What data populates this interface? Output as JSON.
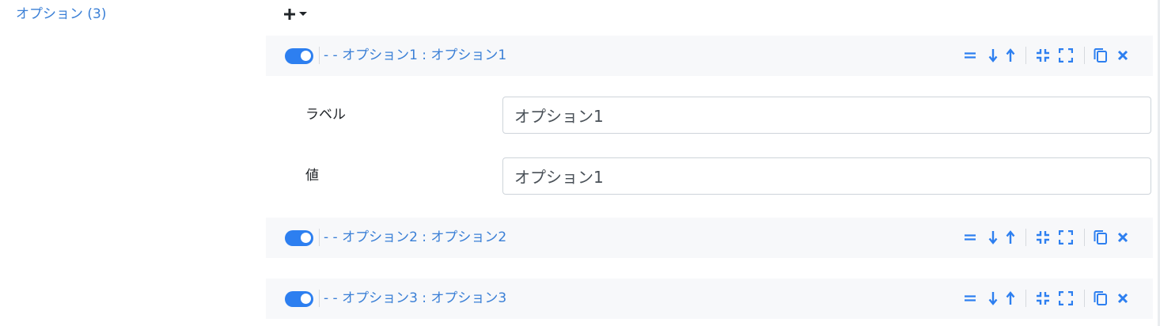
{
  "section": {
    "title": "オプション (3)"
  },
  "colors": {
    "accent": "#3a7fd6",
    "toggle_on": "#2d7ff0",
    "header_bg": "#f7f8fa"
  },
  "options": [
    {
      "title": "- - オプション1 : オプション1",
      "enabled": true,
      "expanded": true,
      "fields": {
        "label_caption": "ラベル",
        "label_value": "オプション1",
        "value_caption": "値",
        "value_value": "オプション1"
      }
    },
    {
      "title": "- - オプション2 : オプション2",
      "enabled": true,
      "expanded": false
    },
    {
      "title": "- - オプション3 : オプション3",
      "enabled": true,
      "expanded": false
    }
  ],
  "icons": {
    "add": "plus-icon",
    "add_menu": "caret-down-icon",
    "drag": "drag-handle-icon",
    "move_down": "arrow-down-icon",
    "move_up": "arrow-up-icon",
    "collapse": "compress-icon",
    "expand": "expand-icon",
    "duplicate": "copy-icon",
    "remove": "close-icon"
  }
}
